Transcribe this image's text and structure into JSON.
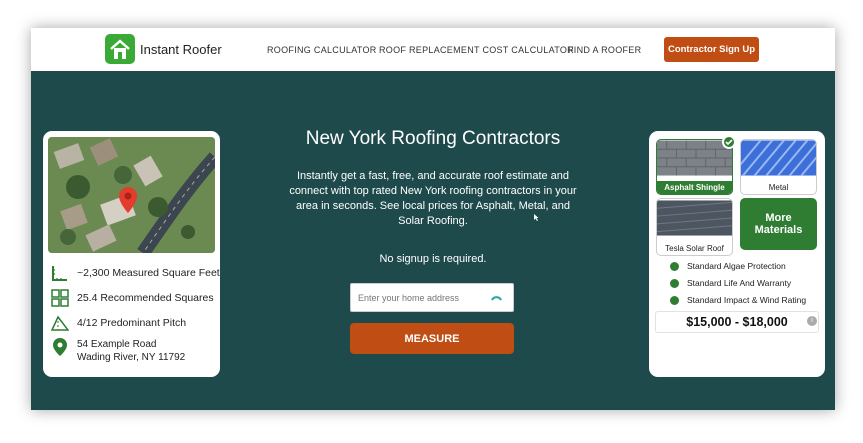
{
  "nav": {
    "logo_text": "Instant Roofer",
    "links": [
      "ROOFING CALCULATOR",
      "ROOF REPLACEMENT COST CALCULATOR",
      "FIND A ROOFER"
    ],
    "cta": "Contractor Sign Up"
  },
  "property": {
    "stats": [
      {
        "icon": "ruler-icon",
        "text": "~2,300 Measured Square Feet"
      },
      {
        "icon": "grid-squares-icon",
        "text": "25.4 Recommended Squares"
      },
      {
        "icon": "pitch-triangle-icon",
        "text": "4/12  Predominant Pitch"
      }
    ],
    "address_icon": "map-pin-icon",
    "address_line1": "54 Example Road",
    "address_line2": "Wading River, NY 11792"
  },
  "hero": {
    "title": "New York Roofing Contractors",
    "description": "Instantly get a fast, free, and accurate roof estimate and connect with top rated New York roofing contractors in your area in seconds. See local prices for Asphalt, Metal, and Solar Roofing.",
    "no_signup": "No signup is required.",
    "address_placeholder": "Enter your home address",
    "measure_label": "MEASURE"
  },
  "materials": {
    "tiles": [
      {
        "label": "Asphalt Shingle",
        "selected": true
      },
      {
        "label": "Metal",
        "selected": false
      },
      {
        "label": "Tesla Solar Roof",
        "selected": false
      }
    ],
    "more_label_1": "More",
    "more_label_2": "Materials",
    "features": [
      "Standard Algae Protection",
      "Standard Life And Warranty",
      "Standard Impact & Wind Rating"
    ],
    "price": "$15,000 - $18,000"
  },
  "colors": {
    "background": "#1e4a4b",
    "accent": "#c04d13",
    "green": "#2e7d33"
  }
}
